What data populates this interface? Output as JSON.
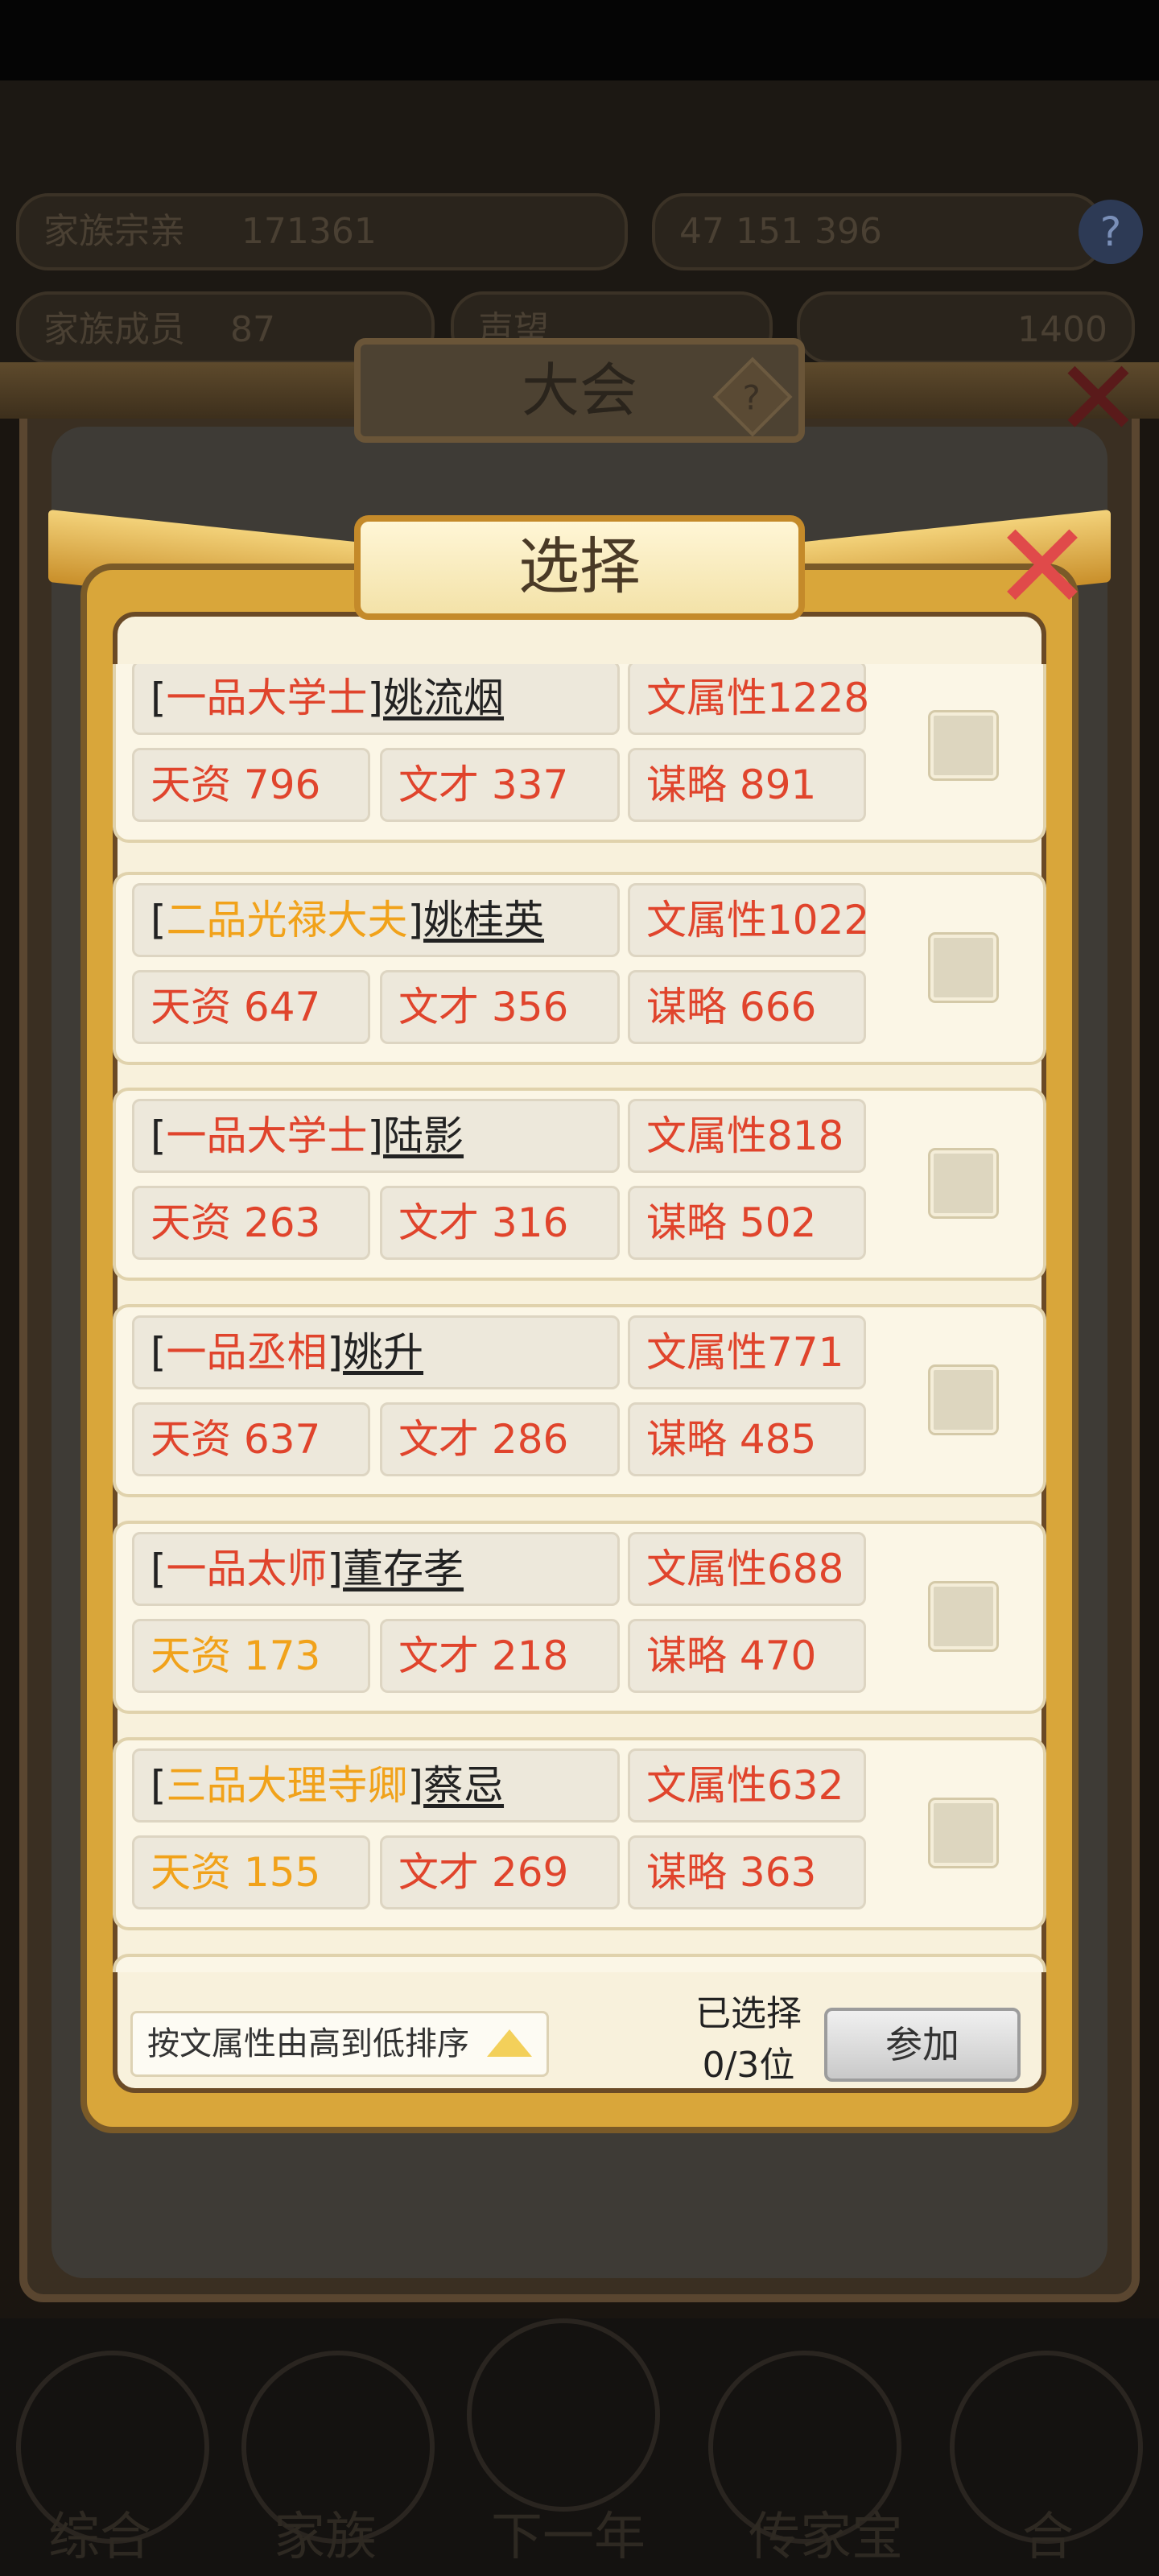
{
  "background": {
    "stat_pills": [
      {
        "label": "家族宗亲",
        "value": "171361"
      },
      {
        "label": "",
        "value": "47 151 396"
      },
      {
        "label": "家族成员",
        "value": "87"
      },
      {
        "label": "声望",
        "value": "1400"
      }
    ],
    "help_icon": "?",
    "panel_title": "大会",
    "bottom_nav": [
      "综合",
      "家族",
      "下一年",
      "传家宝",
      "合"
    ]
  },
  "modal": {
    "title": "选择",
    "close_icon": "close-icon"
  },
  "candidates": [
    {
      "rank": "一品大学士",
      "rank_color": "red",
      "name": "姚流烟",
      "attr": "文属性1228",
      "talent": "天资 796",
      "talent_color": "red",
      "literary": "文才 337",
      "strategy": "谋略 891"
    },
    {
      "rank": "二品光禄大夫",
      "rank_color": "orange",
      "name": "姚桂英",
      "attr": "文属性1022",
      "talent": "天资 647",
      "talent_color": "red",
      "literary": "文才 356",
      "strategy": "谋略 666"
    },
    {
      "rank": "一品大学士",
      "rank_color": "red",
      "name": "陆影",
      "attr": "文属性818",
      "talent": "天资 263",
      "talent_color": "red",
      "literary": "文才 316",
      "strategy": "谋略 502"
    },
    {
      "rank": "一品丞相",
      "rank_color": "red",
      "name": "姚升",
      "attr": "文属性771",
      "talent": "天资 637",
      "talent_color": "red",
      "literary": "文才 286",
      "strategy": "谋略 485"
    },
    {
      "rank": "一品太师",
      "rank_color": "red",
      "name": "董存孝",
      "attr": "文属性688",
      "talent": "天资 173",
      "talent_color": "orange",
      "literary": "文才 218",
      "strategy": "谋略 470"
    },
    {
      "rank": "三品大理寺卿",
      "rank_color": "orange",
      "name": "蔡忌",
      "attr": "文属性632",
      "talent": "天资 155",
      "talent_color": "orange",
      "literary": "文才 269",
      "strategy": "谋略 363"
    }
  ],
  "footer": {
    "sort_label": "按文属性由高到低排序",
    "selected_label": "已选择",
    "selected_count": "0/3位",
    "join_label": "参加"
  }
}
